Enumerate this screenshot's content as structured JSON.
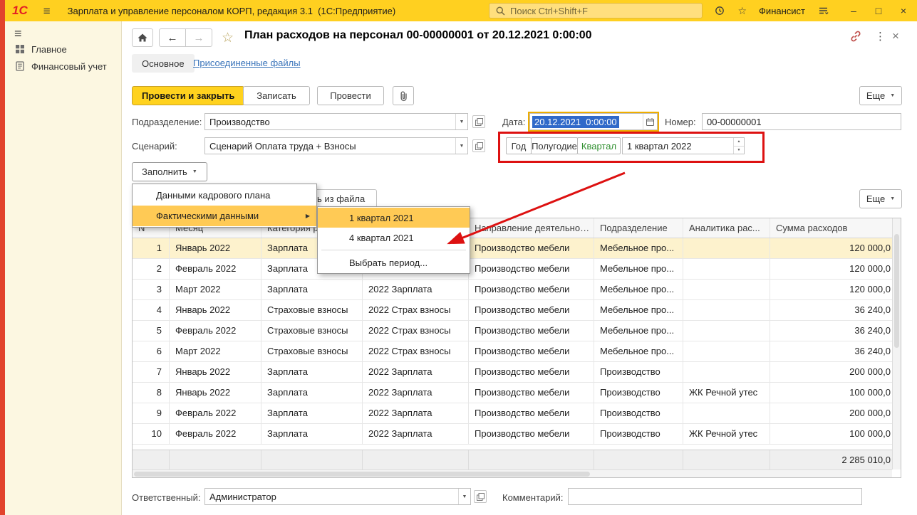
{
  "colors": {
    "brand_red": "#e31e24",
    "topbar_yellow": "#ffd020",
    "edge_red": "#e2432c",
    "annotation_red": "#dd1111",
    "menu_highlight": "#ffca55",
    "selected_row": "#fdf2cd",
    "link_blue": "#3a74ba",
    "quarter_green": "#2f8f2f",
    "selection_blue": "#3069c9"
  },
  "icons": {
    "menu": "≡",
    "back": "←",
    "forward": "→",
    "star": "☆",
    "dots": "⋮",
    "close": "×",
    "minimize": "–",
    "maximize": "□",
    "dropdown": "▼",
    "submenu_arrow": "▶",
    "spin_up": "▲",
    "spin_down": "▼"
  },
  "topbar": {
    "logo": "1С",
    "title": "Зарплата и управление персоналом КОРП, редакция 3.1  (1С:Предприятие)",
    "search_placeholder": "Поиск Ctrl+Shift+F",
    "user": "Финансист"
  },
  "sidebar": {
    "items": [
      {
        "label": "Главное"
      },
      {
        "label": "Финансовый учет"
      }
    ]
  },
  "doc": {
    "title": "План расходов на персонал 00-00000001 от 20.12.2021 0:00:00",
    "tab_main": "Основное",
    "tab_files": "Присоединенные файлы",
    "btn_post_close": "Провести и закрыть",
    "btn_save": "Записать",
    "btn_post": "Провести",
    "btn_more": "Еще",
    "department_label": "Подразделение:",
    "department_value": "Производство",
    "date_label": "Дата:",
    "date_value": "20.12.2021  0:00:00",
    "number_label": "Номер:",
    "number_value": "00-00000001",
    "scenario_label": "Сценарий:",
    "scenario_value": "Сценарий Оплата труда + Взносы",
    "period_year": "Год",
    "period_half": "Полугодие",
    "period_quarter": "Квартал",
    "period_value": "1 квартал 2022",
    "fill_label": "Заполнить",
    "covered_button_fragment": "ь из файла",
    "table_more": "Еще"
  },
  "menu": {
    "item_staff_plan": "Данными кадрового плана",
    "item_actual": "Фактическими данными",
    "sub_q1_2021": "1 квартал 2021",
    "sub_q4_2021": "4 квартал 2021",
    "sub_choose": "Выбрать период..."
  },
  "table": {
    "columns": [
      "N",
      "Месяц",
      "Категория р...",
      "",
      "Направление деятельности",
      "Подразделение",
      "Аналитика рас...",
      "Сумма расходов"
    ],
    "rows": [
      {
        "n": "1",
        "month": "Январь 2022",
        "category": "Зарплата",
        "item": "",
        "direction": "Производство мебели",
        "department": "Мебельное про...",
        "analytics": "",
        "amount": "120 000,0",
        "selected": true
      },
      {
        "n": "2",
        "month": "Февраль 2022",
        "category": "Зарплата",
        "item": "",
        "direction": "Производство мебели",
        "department": "Мебельное про...",
        "analytics": "",
        "amount": "120 000,0"
      },
      {
        "n": "3",
        "month": "Март 2022",
        "category": "Зарплата",
        "item": "2022 Зарплата",
        "direction": "Производство мебели",
        "department": "Мебельное про...",
        "analytics": "",
        "amount": "120 000,0"
      },
      {
        "n": "4",
        "month": "Январь 2022",
        "category": "Страховые взносы",
        "item": "2022 Страх взносы",
        "direction": "Производство мебели",
        "department": "Мебельное про...",
        "analytics": "",
        "amount": "36 240,0"
      },
      {
        "n": "5",
        "month": "Февраль 2022",
        "category": "Страховые взносы",
        "item": "2022 Страх взносы",
        "direction": "Производство мебели",
        "department": "Мебельное про...",
        "analytics": "",
        "amount": "36 240,0"
      },
      {
        "n": "6",
        "month": "Март 2022",
        "category": "Страховые взносы",
        "item": "2022 Страх взносы",
        "direction": "Производство мебели",
        "department": "Мебельное про...",
        "analytics": "",
        "amount": "36 240,0"
      },
      {
        "n": "7",
        "month": "Январь 2022",
        "category": "Зарплата",
        "item": "2022 Зарплата",
        "direction": "Производство мебели",
        "department": "Производство",
        "analytics": "",
        "amount": "200 000,0"
      },
      {
        "n": "8",
        "month": "Январь 2022",
        "category": "Зарплата",
        "item": "2022 Зарплата",
        "direction": "Производство мебели",
        "department": "Производство",
        "analytics": "ЖК Речной утес",
        "amount": "100 000,0"
      },
      {
        "n": "9",
        "month": "Февраль 2022",
        "category": "Зарплата",
        "item": "2022 Зарплата",
        "direction": "Производство мебели",
        "department": "Производство",
        "analytics": "",
        "amount": "200 000,0"
      },
      {
        "n": "10",
        "month": "Февраль 2022",
        "category": "Зарплата",
        "item": "2022 Зарплата",
        "direction": "Производство мебели",
        "department": "Производство",
        "analytics": "ЖК Речной утес",
        "amount": "100 000,0"
      }
    ],
    "total": "2 285 010,0"
  },
  "footer": {
    "responsible_label": "Ответственный:",
    "responsible_value": "Администратор",
    "comment_label": "Комментарий:",
    "comment_value": ""
  }
}
